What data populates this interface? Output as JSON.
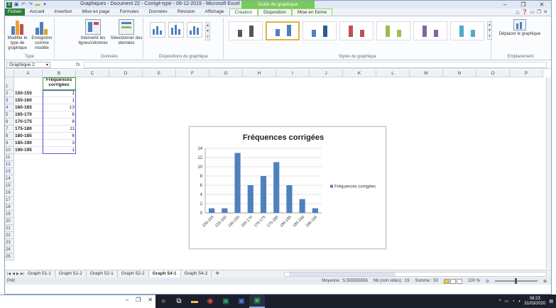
{
  "window": {
    "title": "Graphiques - Document 22 - Corrigé-type - 09-12-2019 - Microsoft Excel",
    "context_title": "Outils de graphique",
    "controls": [
      "–",
      "❐",
      "✕"
    ]
  },
  "tabs": [
    "Fichier",
    "Accueil",
    "Insertion",
    "Mise en page",
    "Formules",
    "Données",
    "Révision",
    "Affichage",
    "Création",
    "Disposition",
    "Mise en forme"
  ],
  "ribbon": {
    "type_group": {
      "label": "Type",
      "buttons": [
        "Modifier le type de graphique",
        "Enregistrer comme modèle"
      ]
    },
    "data_group": {
      "label": "Données",
      "buttons": [
        "Intervertir les lignes/colonnes",
        "Sélectionner des données"
      ]
    },
    "layouts_group": {
      "label": "Dispositions du graphique"
    },
    "styles_group": {
      "label": "Styles du graphique"
    },
    "location_group": {
      "label": "Emplacement",
      "button": "Déplacer le graphique"
    }
  },
  "formula_bar": {
    "name_box": "Graphique 2",
    "fx": "fx",
    "value": ""
  },
  "columns": [
    "A",
    "B",
    "C",
    "D",
    "E",
    "F",
    "G",
    "H",
    "I",
    "J",
    "K",
    "L",
    "M",
    "N",
    "O",
    "P"
  ],
  "rows": [
    "1",
    "2",
    "3",
    "4",
    "5",
    "6",
    "7",
    "8",
    "9",
    "10",
    "11",
    "12",
    "13",
    "14",
    "15",
    "16",
    "17",
    "18",
    "19",
    "20",
    "21",
    "22",
    "23",
    "24",
    "25"
  ],
  "table": {
    "header": "Fréquences corrigées",
    "labels": [
      "150-155",
      "155-160",
      "160-165",
      "165-170",
      "170-175",
      "175-180",
      "180-185",
      "185-190",
      "190-195"
    ],
    "values": [
      "1",
      "1",
      "13",
      "6",
      "8",
      "11",
      "6",
      "3",
      "1"
    ]
  },
  "chart_data": {
    "type": "bar",
    "title": "Fréquences corrigées",
    "categories": [
      "150-155",
      "155-160",
      "160-165",
      "165-170",
      "170-175",
      "175-180",
      "180-185",
      "185-190",
      "190-195"
    ],
    "series": [
      {
        "name": "Fréquences corrigées",
        "values": [
          1,
          1,
          13,
          6,
          8,
          11,
          6,
          3,
          1
        ],
        "color": "#4f81bd"
      }
    ],
    "y_ticks": [
      "0",
      "2",
      "4",
      "6",
      "8",
      "10",
      "12",
      "14"
    ],
    "ylim": [
      0,
      14
    ],
    "grid": true,
    "legend": "right"
  },
  "sheets": [
    "Graph 51-1",
    "Graph 51-2",
    "Graph 52-1",
    "Graph 52-2",
    "Graph 54-1",
    "Graph 54-2"
  ],
  "active_sheet": "Graph 54-1",
  "status": {
    "ready": "Prêt",
    "average": "Moyenne : 5,555555556",
    "count": "Nb (non vides) : 19",
    "sum": "Somme : 50",
    "zoom": "100 %"
  },
  "taskbar": {
    "time": "08:23",
    "date": "31/03/2020"
  },
  "colors": {
    "accent": "#2e7d32",
    "bar": "#4f81bd",
    "context": "#7ac95c"
  }
}
